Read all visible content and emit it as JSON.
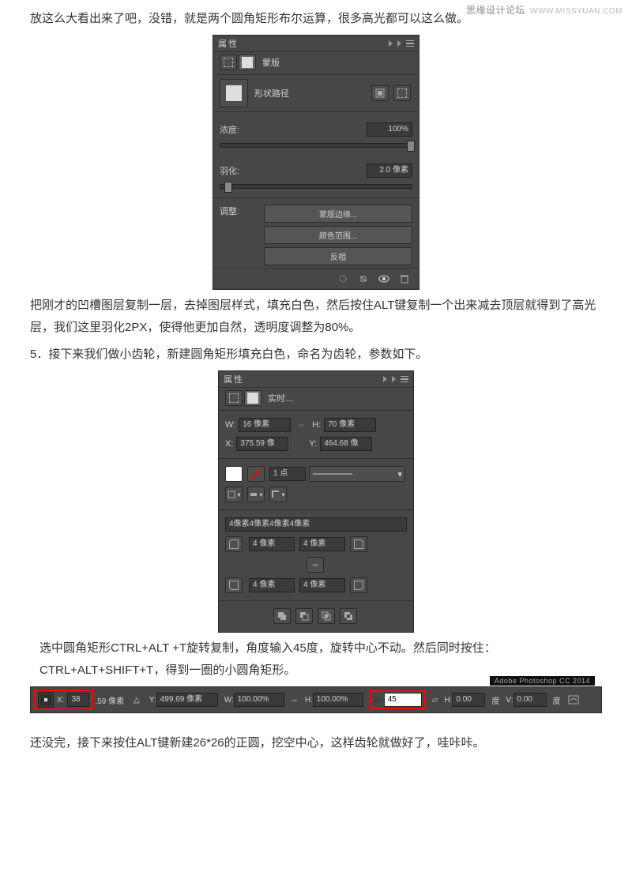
{
  "watermark": {
    "cn": "思缘设计论坛",
    "url": "WWW.MISSYUAN.COM"
  },
  "text": {
    "p1": "放这么大看出来了吧，没错，就是两个圆角矩形布尔运算，很多高光都可以这么做。",
    "p2a": "把刚才的凹槽图层复制一层，去掉图层样式，填充白色，然后按住ALT键复制一个出来减去顶层就得到了高光层，我们这里羽化2PX，使得他更加自然，透明度调整为80%。",
    "p2b": "5．接下来我们做小齿轮，新建圆角矩形填充白色，命名为齿轮，参数如下。",
    "p3a": "选中圆角矩形CTRL+ALT +T旋转复制，角度输入45度，旋转中心不动。然后同时按住：CTRL+ALT+SHIFT+T，得到一圈的小圆角矩形。",
    "p4": "还没完，接下来按住ALT键新建26*26的正圆，挖空中心，这样齿轮就做好了，哇咔咔。"
  },
  "panel1": {
    "title": "属性",
    "mask": "蒙版",
    "shapePath": "形状路径",
    "density": {
      "label": "浓度:",
      "value": "100%",
      "pos": "99%"
    },
    "feather": {
      "label": "羽化:",
      "value": "2.0 像素",
      "pos": "2%"
    },
    "adjust": "调整:",
    "btns": {
      "edge": "蒙版边缘...",
      "range": "颜色范围...",
      "invert": "反相"
    }
  },
  "panel2": {
    "title": "属性",
    "live": "实时…",
    "W": {
      "label": "W:",
      "value": "16 像素"
    },
    "H": {
      "label": "H:",
      "value": "70 像素"
    },
    "X": {
      "label": "X:",
      "value": "375.59 像"
    },
    "Y": {
      "label": "Y:",
      "value": "464.68 像"
    },
    "stroke": "1 点",
    "radii": "4像素4像素4像素4像素",
    "r": "4 像素"
  },
  "tbar": {
    "adobe": "Adobe Photoshop CC 2014",
    "X": {
      "l": "X:",
      "v": "38"
    },
    "Xrest": ".59 像素",
    "Y": {
      "l": "Y:",
      "v": "499.69 像素"
    },
    "W": {
      "l": "W:",
      "v": "100.00%"
    },
    "H": {
      "l": "H:",
      "v": "100.00%"
    },
    "angle": {
      "v": "45"
    },
    "Hs": {
      "l": "H:",
      "v": "0.00"
    },
    "deg": "度",
    "V": {
      "l": "V:",
      "v": "0.00"
    }
  }
}
